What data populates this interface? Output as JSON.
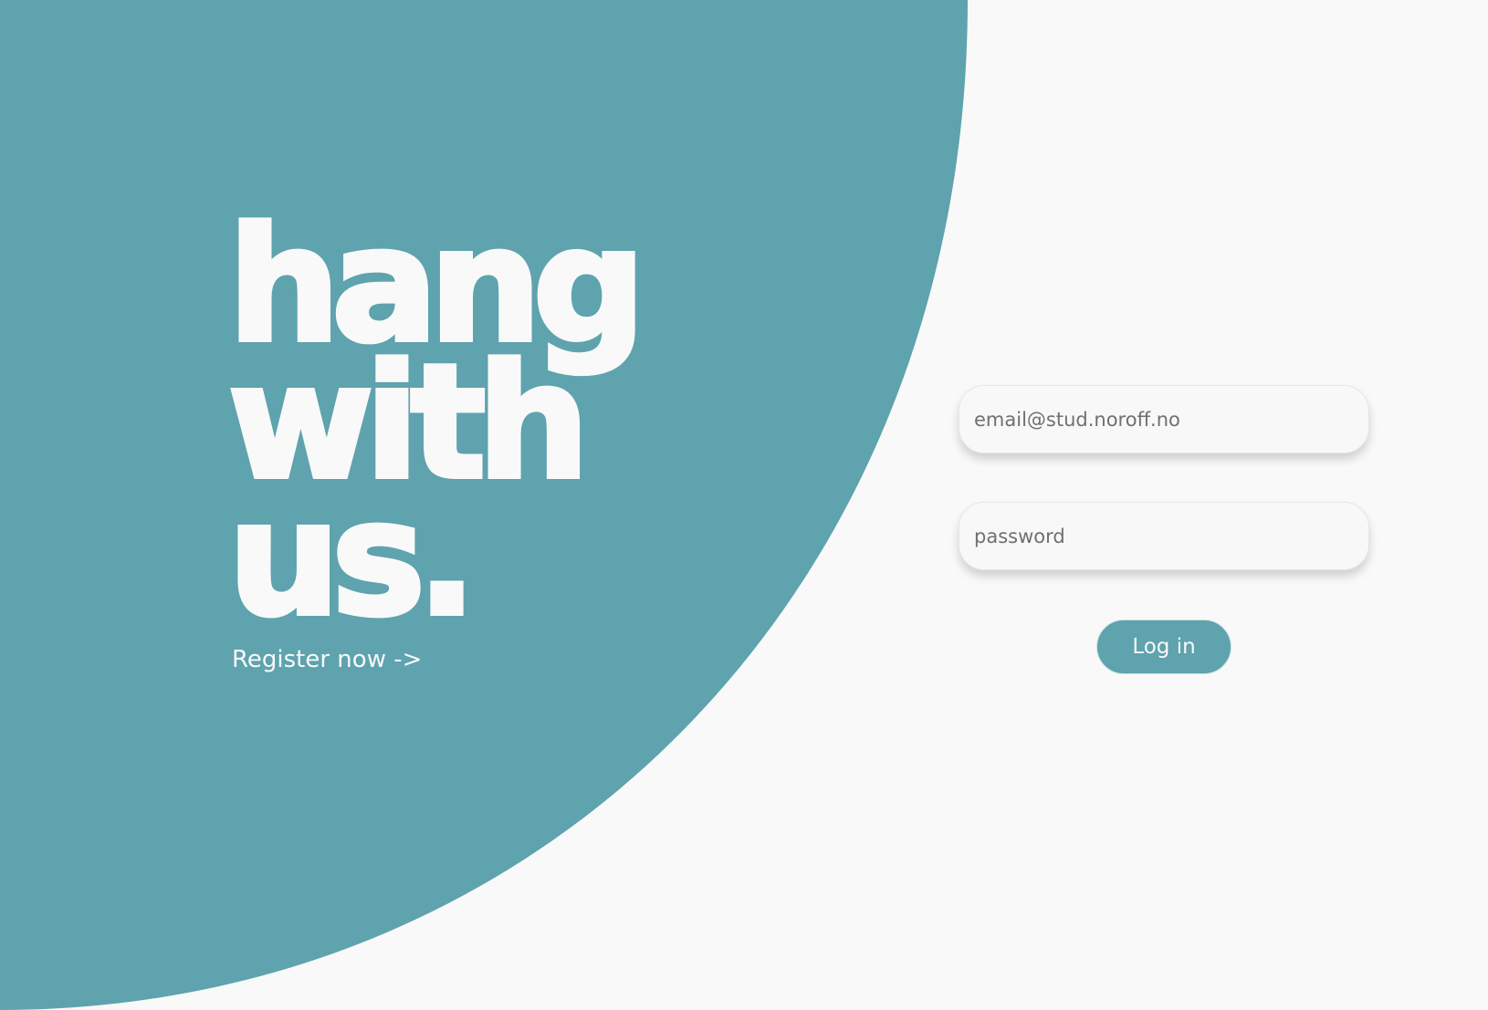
{
  "hero": {
    "line1": "hang",
    "line2": "with",
    "line3": "us.",
    "register_link": "Register now ->"
  },
  "login_form": {
    "email_placeholder": "email@stud.noroff.no",
    "password_placeholder": "password",
    "login_button": "Log in"
  },
  "colors": {
    "accent": "#5ea3ae",
    "background": "#f9f9f9",
    "text_on_accent": "#f9f9f9"
  }
}
